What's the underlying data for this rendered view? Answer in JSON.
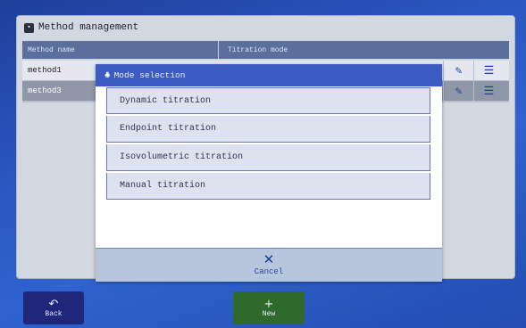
{
  "window": {
    "title": "Method management"
  },
  "table": {
    "columns": [
      "Method name",
      "Titration mode"
    ],
    "rows": [
      {
        "name": "method1"
      },
      {
        "name": "method3"
      }
    ]
  },
  "dialog": {
    "title": "Mode selection",
    "options": [
      "Dynamic titration",
      "Endpoint titration",
      "Isovolumetric titration",
      "Manual titration"
    ],
    "cancel_label": "Cancel"
  },
  "buttons": {
    "back_label": "Back",
    "new_label": "New"
  },
  "icons": {
    "dialog_title": "network-icon",
    "edit": "pencil-icon",
    "list": "list-icon",
    "cancel": "close-icon",
    "back": "back-arrow-icon",
    "new": "plus-icon"
  }
}
